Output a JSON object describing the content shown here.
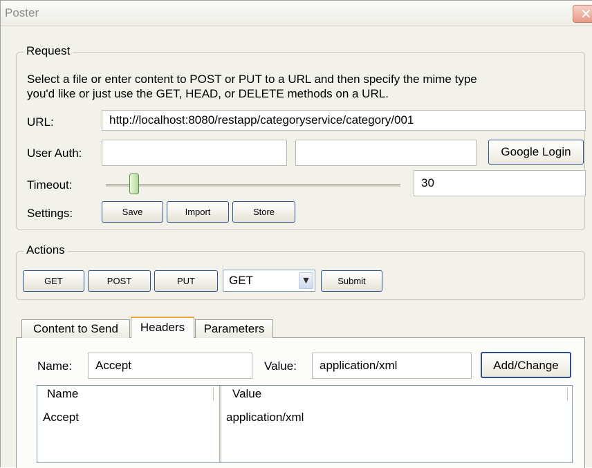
{
  "window": {
    "title": "Poster",
    "close_icon": "close-icon"
  },
  "request": {
    "legend": "Request",
    "description_line1": "Select a file or enter content to POST or PUT to a URL and then specify the mime type",
    "description_line2": "you'd like or just use the GET, HEAD, or DELETE methods on a URL.",
    "url_label": "URL:",
    "url_value": "http://localhost:8080/restapp/categoryservice/category/001",
    "user_auth_label": "User Auth:",
    "user_value": "",
    "password_value": "",
    "google_login_label": "Google Login",
    "timeout_label": "Timeout:",
    "timeout_value": "30",
    "settings_label": "Settings:",
    "save_label": "Save",
    "import_label": "Import",
    "store_label": "Store"
  },
  "actions": {
    "legend": "Actions",
    "get_label": "GET",
    "post_label": "POST",
    "put_label": "PUT",
    "method_selected": "GET",
    "submit_label": "Submit"
  },
  "tabs": {
    "items": [
      "Content to Send",
      "Headers",
      "Parameters"
    ],
    "active": "Headers"
  },
  "headers": {
    "name_label": "Name:",
    "name_value": "Accept",
    "value_label": "Value:",
    "value_value": "application/xml",
    "add_change_label": "Add/Change",
    "columns": [
      "Name",
      "Value"
    ],
    "rows": [
      {
        "name": "Accept",
        "value": "application/xml"
      }
    ]
  }
}
